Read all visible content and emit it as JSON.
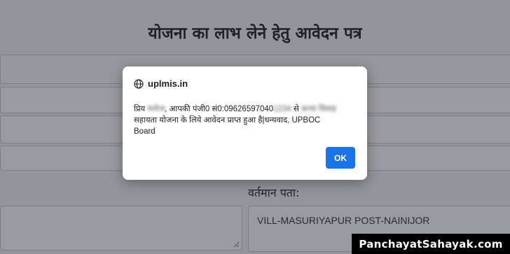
{
  "page": {
    "title": "योजना का लाभ लेने हेतु आवेदन पत्र",
    "address_label": "वर्तमान पता:",
    "address_value": "VILL-MASURIYAPUR POST-NAINIJOR"
  },
  "dialog": {
    "domain": "uplmis.in",
    "icon": "globe-icon",
    "msg_prefix": "प्रिय ",
    "msg_name_blurred": "मनोज",
    "msg_mid": ", आपकी पंजी0 सं0:09626597040",
    "msg_id_blurred": "1234",
    "msg_se": " से ",
    "msg_scheme_blurred": "कन्या विवाह",
    "msg_line2": "सहायता योजना के लिये आवेदन प्राप्त हुआ है|धन्यवाद, UPBOC",
    "msg_line3": "Board",
    "ok_label": "OK",
    "ok_color": "#1a73e8"
  },
  "watermark": {
    "text": "PanchayatSahayak.com"
  }
}
